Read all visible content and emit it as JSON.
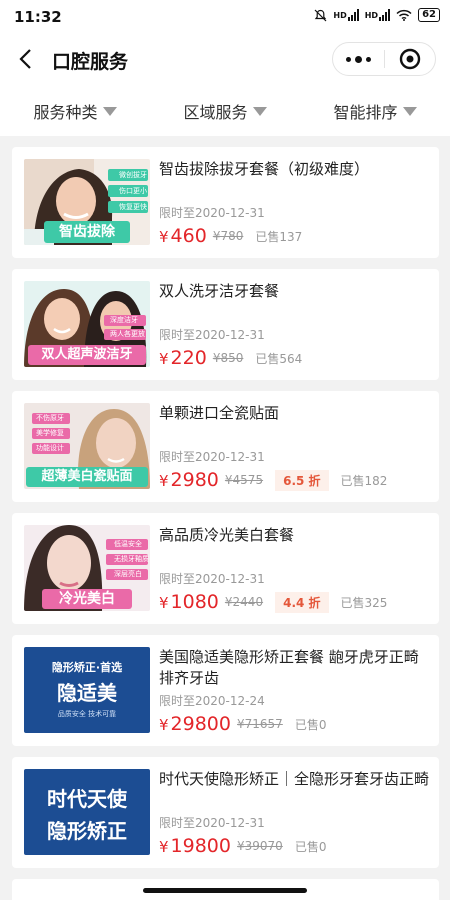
{
  "status_bar": {
    "time": "11:32",
    "network_1": "HD",
    "network_2": "HD",
    "battery": "62",
    "icons": [
      "notification-icon",
      "signal-icon",
      "wifi-icon",
      "battery-icon"
    ]
  },
  "nav": {
    "title": "口腔服务",
    "back_icon": "back-arrow-icon",
    "more_icon": "more-dots-icon",
    "close_icon": "target-close-icon"
  },
  "filters": [
    {
      "label": "服务种类"
    },
    {
      "label": "区域服务"
    },
    {
      "label": "智能排序"
    }
  ],
  "products": [
    {
      "name": "智齿拔除拔牙套餐（初级难度）",
      "thumb_label": "智齿拔除",
      "thumb_tags": [
        "微创拔牙",
        "伤口更小",
        "恢复更快"
      ],
      "limit": "限时至2020-12-31",
      "price": "460",
      "original_price": "¥780",
      "discount": "",
      "sold": "已售137"
    },
    {
      "name": "双人洗牙洁牙套餐",
      "thumb_label": "双人超声波洁牙",
      "thumb_tags": [
        "深度洁牙",
        "两人各更放"
      ],
      "limit": "限时至2020-12-31",
      "price": "220",
      "original_price": "¥850",
      "discount": "",
      "sold": "已售564"
    },
    {
      "name": "单颗进口全瓷贴面",
      "thumb_label": "超薄美白瓷贴面",
      "thumb_tags": [
        "不伤原牙",
        "美学修复",
        "功能设计"
      ],
      "limit": "限时至2020-12-31",
      "price": "2980",
      "original_price": "¥4575",
      "discount": "6.5 折",
      "sold": "已售182"
    },
    {
      "name": "高品质冷光美白套餐",
      "thumb_label": "冷光美白",
      "thumb_tags": [
        "低温安全",
        "无损牙釉质",
        "深层亮白"
      ],
      "limit": "限时至2020-12-31",
      "price": "1080",
      "original_price": "¥2440",
      "discount": "4.4 折",
      "sold": "已售325"
    },
    {
      "name": "美国隐适美隐形矫正套餐 龅牙虎牙正畸 排齐牙齿",
      "thumb_label": "隐适美",
      "thumb_top": "隐形矫正·首选",
      "thumb_sub": "品质安全 技术可靠",
      "limit": "限时至2020-12-24",
      "price": "29800",
      "original_price": "¥71657",
      "discount": "",
      "sold": "已售0"
    },
    {
      "name": "时代天使隐形矫正｜全隐形牙套牙齿正畸",
      "thumb_label": "隐形矫正",
      "thumb_top": "时代天使",
      "limit": "限时至2020-12-31",
      "price": "19800",
      "original_price": "¥39070",
      "discount": "",
      "sold": "已售0"
    }
  ],
  "currency_symbol": "¥",
  "colors": {
    "price": "#e3262a",
    "accent_green": "#3ec9a7",
    "accent_pink": "#ea6aa8",
    "accent_blue": "#1c4d93"
  }
}
